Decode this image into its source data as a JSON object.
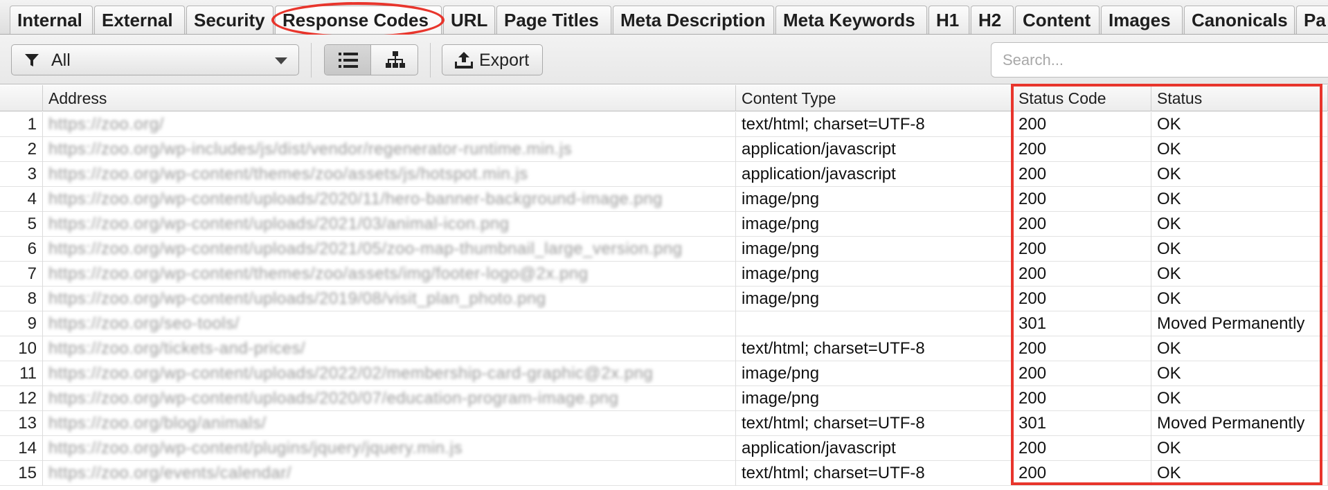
{
  "tabs": [
    {
      "label": "Internal",
      "active": false
    },
    {
      "label": "External",
      "active": false
    },
    {
      "label": "Security",
      "active": false
    },
    {
      "label": "Response Codes",
      "active": true
    },
    {
      "label": "URL",
      "active": false
    },
    {
      "label": "Page Titles",
      "active": false
    },
    {
      "label": "Meta Description",
      "active": false
    },
    {
      "label": "Meta Keywords",
      "active": false
    },
    {
      "label": "H1",
      "active": false
    },
    {
      "label": "H2",
      "active": false
    },
    {
      "label": "Content",
      "active": false
    },
    {
      "label": "Images",
      "active": false
    },
    {
      "label": "Canonicals",
      "active": false
    },
    {
      "label": "Pa",
      "active": false
    }
  ],
  "toolbar": {
    "filter": {
      "value": "All",
      "icon": "funnel-icon"
    },
    "view_modes": [
      {
        "name": "list-view",
        "icon": "list-icon",
        "selected": true
      },
      {
        "name": "tree-view",
        "icon": "tree-icon",
        "selected": false
      }
    ],
    "export_label": "Export",
    "search_placeholder": "Search..."
  },
  "table": {
    "columns": [
      "",
      "Address",
      "Content Type",
      "Status Code",
      "Status"
    ],
    "rows": [
      {
        "n": "1",
        "address": "https://zoo.org/",
        "content_type": "text/html; charset=UTF-8",
        "status_code": "200",
        "status": "OK"
      },
      {
        "n": "2",
        "address": "https://zoo.org/wp-includes/js/dist/vendor/regenerator-runtime.min.js",
        "content_type": "application/javascript",
        "status_code": "200",
        "status": "OK"
      },
      {
        "n": "3",
        "address": "https://zoo.org/wp-content/themes/zoo/assets/js/hotspot.min.js",
        "content_type": "application/javascript",
        "status_code": "200",
        "status": "OK"
      },
      {
        "n": "4",
        "address": "https://zoo.org/wp-content/uploads/2020/11/hero-banner-background-image.png",
        "content_type": "image/png",
        "status_code": "200",
        "status": "OK"
      },
      {
        "n": "5",
        "address": "https://zoo.org/wp-content/uploads/2021/03/animal-icon.png",
        "content_type": "image/png",
        "status_code": "200",
        "status": "OK"
      },
      {
        "n": "6",
        "address": "https://zoo.org/wp-content/uploads/2021/05/zoo-map-thumbnail_large_version.png",
        "content_type": "image/png",
        "status_code": "200",
        "status": "OK"
      },
      {
        "n": "7",
        "address": "https://zoo.org/wp-content/themes/zoo/assets/img/footer-logo@2x.png",
        "content_type": "image/png",
        "status_code": "200",
        "status": "OK"
      },
      {
        "n": "8",
        "address": "https://zoo.org/wp-content/uploads/2019/08/visit_plan_photo.png",
        "content_type": "image/png",
        "status_code": "200",
        "status": "OK"
      },
      {
        "n": "9",
        "address": "https://zoo.org/seo-tools/",
        "content_type": "",
        "status_code": "301",
        "status": "Moved Permanently"
      },
      {
        "n": "10",
        "address": "https://zoo.org/tickets-and-prices/",
        "content_type": "text/html; charset=UTF-8",
        "status_code": "200",
        "status": "OK"
      },
      {
        "n": "11",
        "address": "https://zoo.org/wp-content/uploads/2022/02/membership-card-graphic@2x.png",
        "content_type": "image/png",
        "status_code": "200",
        "status": "OK"
      },
      {
        "n": "12",
        "address": "https://zoo.org/wp-content/uploads/2020/07/education-program-image.png",
        "content_type": "image/png",
        "status_code": "200",
        "status": "OK"
      },
      {
        "n": "13",
        "address": "https://zoo.org/blog/animals/",
        "content_type": "text/html; charset=UTF-8",
        "status_code": "301",
        "status": "Moved Permanently"
      },
      {
        "n": "14",
        "address": "https://zoo.org/wp-content/plugins/jquery/jquery.min.js",
        "content_type": "application/javascript",
        "status_code": "200",
        "status": "OK"
      },
      {
        "n": "15",
        "address": "https://zoo.org/events/calendar/",
        "content_type": "text/html; charset=UTF-8",
        "status_code": "200",
        "status": "OK"
      }
    ]
  },
  "colors": {
    "highlight": "#e8352c"
  }
}
